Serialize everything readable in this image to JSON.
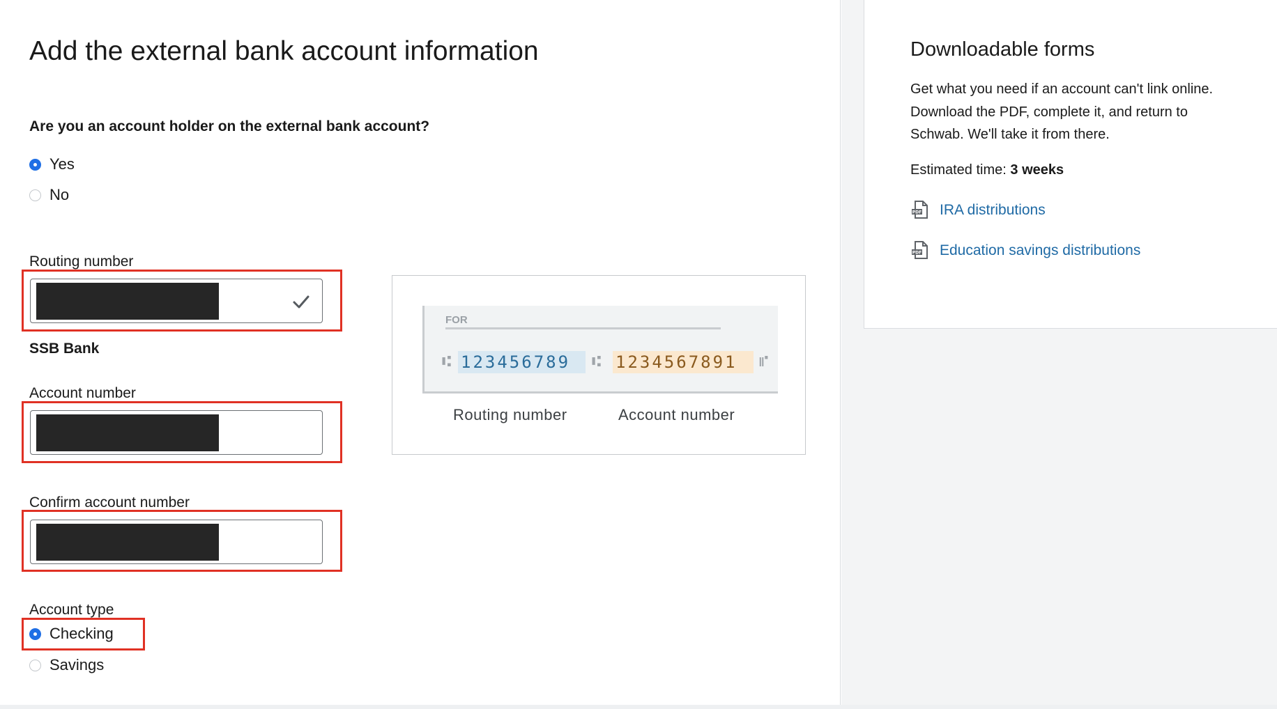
{
  "page": {
    "title": "Add the external bank account information"
  },
  "account_holder": {
    "question": "Are you an account holder on the external bank account?",
    "options": [
      {
        "label": "Yes",
        "checked": true
      },
      {
        "label": "No",
        "checked": false
      }
    ]
  },
  "routing": {
    "label": "Routing number",
    "bank_name": "SSB Bank"
  },
  "account_number": {
    "label": "Account number"
  },
  "confirm_account": {
    "label": "Confirm account number"
  },
  "account_type": {
    "label": "Account type",
    "options": [
      {
        "label": "Checking",
        "checked": true
      },
      {
        "label": "Savings",
        "checked": false
      }
    ]
  },
  "check_illustration": {
    "for_label": "FOR",
    "routing_digits": "123456789",
    "account_digits": "1234567891",
    "routing_caption": "Routing number",
    "account_caption": "Account number"
  },
  "sidebar": {
    "title": "Downloadable forms",
    "description": "Get what you need if an account can't link online. Download the PDF, complete it, and return to Schwab. We'll take it from there.",
    "estimated_label": "Estimated time:",
    "estimated_value": "3 weeks",
    "links": [
      {
        "label": "IRA distributions",
        "icon": "pdf-icon"
      },
      {
        "label": "Education savings distributions",
        "icon": "pdf-icon"
      }
    ]
  },
  "colors": {
    "accent": "#1f6fe5",
    "link": "#1f6aa5",
    "highlight": "#e03124",
    "routing_bg": "#d9e8f2",
    "account_bg": "#fbe8cf"
  }
}
